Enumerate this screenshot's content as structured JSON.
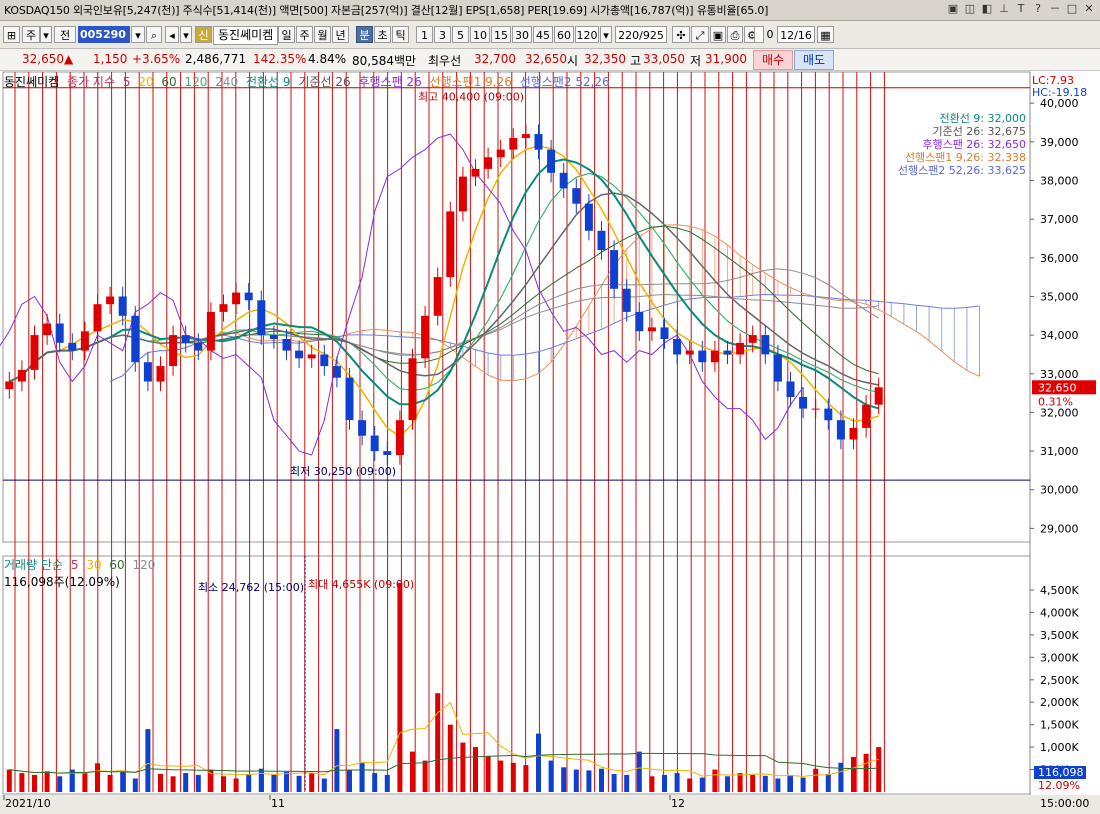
{
  "header": {
    "info": "KOSDAQ150 외국인보유[5,247(천)] 주식수[51,414(천)] 액면[500] 자본금[257(억)] 결산[12월] EPS[1,658] PER[19.69] 시가총액[16,787(억)] 유통비율[65.0]",
    "window_icons": [
      "▣",
      "◫",
      "◧",
      "⊥",
      "T",
      "?",
      "－",
      "□",
      "✕"
    ]
  },
  "toolbar": {
    "market": "주",
    "mode": "전",
    "code": "005290",
    "name": "동진쎄미켐",
    "sin_badge": "신",
    "periods": [
      "일",
      "주",
      "월",
      "년",
      "분",
      "초",
      "틱"
    ],
    "selected_period": "분",
    "intervals": [
      "1",
      "3",
      "5",
      "10",
      "15",
      "30",
      "45",
      "60",
      "120"
    ],
    "count": "220/925",
    "date": "12/16",
    "checkbox_label": "0"
  },
  "quote": {
    "price": "32,650",
    "arrow": "▲",
    "change": "1,150",
    "rate": "+3.65%",
    "volume": "2,486,771",
    "vol_ratio": "142.35%",
    "turnover": "4.84%",
    "amount": "80,584백만",
    "ask_label": "최우선",
    "ask": "32,700",
    "bid": "32,650",
    "open_label": "시",
    "open": "32,350",
    "high_label": "고",
    "high": "33,050",
    "low_label": "저",
    "low": "31,900",
    "buy_label": "매수",
    "sell_label": "매도"
  },
  "price_legend": {
    "name": "동진쎄미켐",
    "ma_label": "종가 지수",
    "ma": [
      "5",
      "20",
      "60",
      "120",
      "240"
    ],
    "tenkan": "전환선 9",
    "kijun": "기준선 26",
    "chikou": "후행스팬 26",
    "senkou1": "선행스팬1 9,26",
    "senkou2": "선행스팬2 52,26"
  },
  "right_top": {
    "lc": "LC:7.93",
    "hc": "HC:-19.18"
  },
  "ichimoku_values": [
    {
      "label": "전환선 9: 32,000",
      "color": "#0a8a7a"
    },
    {
      "label": "기준선 26: 32,675",
      "color": "#555555"
    },
    {
      "label": "후행스팬 26: 32,650",
      "color": "#8a2be2"
    },
    {
      "label": "선행스팬1 9,26: 32,338",
      "color": "#e07a2a"
    },
    {
      "label": "선행스팬2 52,26: 33,625",
      "color": "#5a6ad8"
    }
  ],
  "annotations": {
    "high": "최고 40,400 (09:00)",
    "low": "최저 30,250 (09:00)",
    "vol_max": "최대 4,655K (09:00)",
    "vol_min": "최소 24,762 (15:00)"
  },
  "price_axis": {
    "labels": [
      "40,000",
      "39,000",
      "38,000",
      "37,000",
      "36,000",
      "35,000",
      "34,000",
      "33,000",
      "32,000",
      "31,000",
      "30,000",
      "29,000"
    ],
    "current": "32,650",
    "current_pct": "0.31%"
  },
  "volume_legend": {
    "label": "거래량 단순",
    "ma": [
      "5",
      "30",
      "60",
      "120"
    ],
    "value": "116,098주(12.09%)"
  },
  "volume_axis": {
    "labels": [
      "4,500K",
      "4,000K",
      "3,500K",
      "3,000K",
      "2,500K",
      "2,000K",
      "1,500K",
      "1,000K",
      "500K"
    ],
    "current": "116,098",
    "current_pct": "12.09%"
  },
  "date_axis": {
    "labels": [
      "2021/10",
      "11",
      "12"
    ],
    "time": "15:00:00"
  },
  "colors": {
    "up": "#e00000",
    "down": "#1040d0",
    "ma5": "#f0b400",
    "ma20": "#3cb371",
    "ma60": "#2e6b2e",
    "ma120": "#8c8c8c",
    "tenkan": "#0a8a7a",
    "kijun": "#666666",
    "chikou": "#8a2be2",
    "cloud_up": "#e8905a",
    "cloud_down": "#6a7fe0"
  },
  "chart_data": {
    "type": "candlestick",
    "period": "120-minute",
    "price_range": [
      28700,
      40600
    ],
    "high": 40400,
    "low": 30250,
    "close_series": [
      32800,
      33100,
      34000,
      34300,
      33800,
      33600,
      34100,
      34800,
      35000,
      34500,
      33300,
      32800,
      33200,
      34000,
      33800,
      33600,
      34600,
      34800,
      35100,
      34900,
      34000,
      33900,
      33600,
      33400,
      33500,
      33200,
      32900,
      31800,
      31400,
      31000,
      30900,
      31800,
      33400,
      34500,
      35500,
      37200,
      38100,
      38300,
      38600,
      38800,
      39100,
      39200,
      38800,
      38200,
      37800,
      37400,
      36700,
      36200,
      35200,
      34600,
      34100,
      34200,
      33900,
      33500,
      33600,
      33300,
      33600,
      33500,
      33800,
      34000,
      33500,
      32800,
      32400,
      32100,
      32100,
      31800,
      31300,
      31600,
      32200,
      32650
    ],
    "volume_unit": "K",
    "volume_range": [
      0,
      4900
    ],
    "volumes": [
      500,
      420,
      380,
      460,
      350,
      500,
      420,
      640,
      380,
      450,
      300,
      1400,
      400,
      350,
      420,
      380,
      500,
      350,
      300,
      400,
      520,
      380,
      450,
      360,
      420,
      300,
      1400,
      500,
      650,
      420,
      380,
      4655,
      900,
      700,
      2200,
      1500,
      1100,
      1000,
      800,
      700,
      650,
      600,
      1300,
      700,
      550,
      500,
      480,
      520,
      400,
      380,
      900,
      350,
      380,
      420,
      300,
      320,
      500,
      350,
      420,
      380,
      360,
      300,
      380,
      320,
      520,
      400,
      650,
      780,
      850,
      1000
    ]
  }
}
